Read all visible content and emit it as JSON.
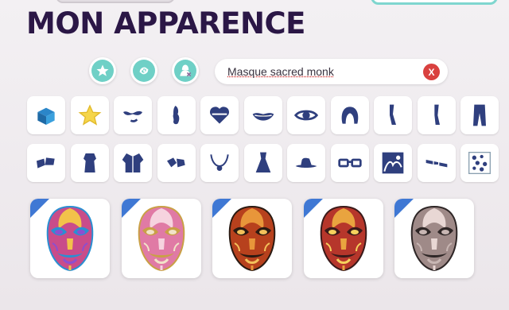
{
  "title": "MON APPARENCE",
  "filters": [
    {
      "name": "favorites-filter",
      "icon": "star-icon"
    },
    {
      "name": "recent-filter",
      "icon": "swirl-icon"
    },
    {
      "name": "hide-filter",
      "icon": "hidden-character-icon"
    }
  ],
  "search": {
    "value": "Masque sacred monk",
    "clear_label": "X"
  },
  "categories_row1": [
    "gift-box-icon",
    "star-icon",
    "face-makeup-icon",
    "skin-icon",
    "heart-tattoo-icon",
    "mouth-icon",
    "eye-icon",
    "hair-icon",
    "arm-icon",
    "leg-icon",
    "pants-icon"
  ],
  "categories_row2": [
    "shoes-icon",
    "top-icon",
    "jacket-icon",
    "gloves-icon",
    "necklace-icon",
    "dress-icon",
    "hat-icon",
    "glasses-icon",
    "background-icon",
    "belt-icon",
    "stickers-icon"
  ],
  "items": [
    {
      "name": "mask-rainbow",
      "colors": [
        "#f2c24a",
        "#2a8fd2",
        "#c94c8a",
        "#8c4fcf"
      ]
    },
    {
      "name": "mask-pastel",
      "colors": [
        "#f6d3df",
        "#c9a046",
        "#e07aa5",
        "#f2e3c8"
      ]
    },
    {
      "name": "mask-fire",
      "colors": [
        "#e8963a",
        "#2a1a12",
        "#b7411d",
        "#f3c15b"
      ]
    },
    {
      "name": "mask-crimson",
      "colors": [
        "#e9a43f",
        "#3a1a1a",
        "#b6362b",
        "#f6d25d"
      ]
    },
    {
      "name": "mask-silver",
      "colors": [
        "#e8d7d4",
        "#2e2626",
        "#9f8a88",
        "#c8b6b3"
      ]
    }
  ],
  "accent_color": "#6fd0c6",
  "category_icon_color": "#2f3f7e"
}
